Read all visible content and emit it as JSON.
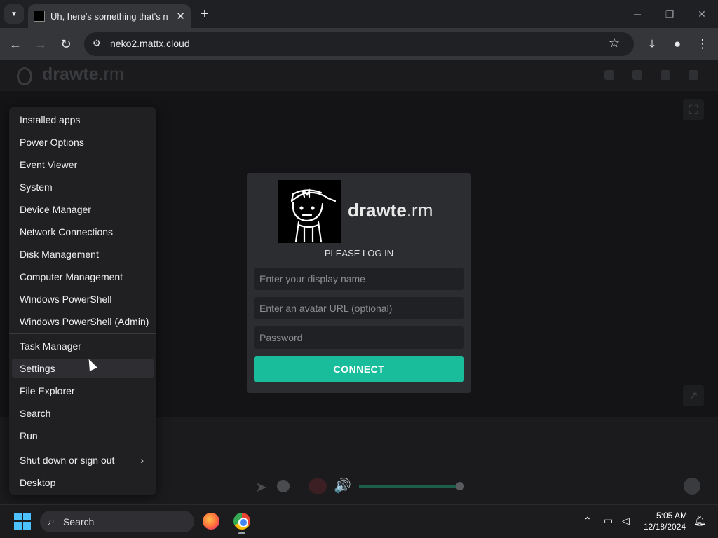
{
  "browser": {
    "tab_title": "Uh, here's something that's new",
    "tab_close": "✕",
    "new_tab": "+",
    "url": "neko2.mattx.cloud"
  },
  "app": {
    "brand_bold": "drawte",
    "brand_light": ".rm"
  },
  "login": {
    "brand_bold": "drawte",
    "brand_light": ".rm",
    "title": "PLEASE LOG IN",
    "display_name_placeholder": "Enter your display name",
    "avatar_placeholder": "Enter an avatar URL (optional)",
    "password_placeholder": "Password",
    "connect_label": "CONNECT"
  },
  "winx_menu": {
    "items": [
      "Installed apps",
      "Power Options",
      "Event Viewer",
      "System",
      "Device Manager",
      "Network Connections",
      "Disk Management",
      "Computer Management",
      "Windows PowerShell",
      "Windows PowerShell (Admin)",
      "Task Manager",
      "Settings",
      "File Explorer",
      "Search",
      "Run",
      "Shut down or sign out",
      "Desktop"
    ],
    "hovered": "Settings"
  },
  "taskbar": {
    "search_label": "Search",
    "time": "5:05 AM",
    "date": "12/18/2024"
  },
  "colors": {
    "accent": "#19bd9c",
    "start_blue": "#4cc2ff"
  },
  "icons": [
    "search-icon",
    "back-icon",
    "forward-icon",
    "reload-icon",
    "site-info-icon",
    "star-icon",
    "download-icon",
    "profile-icon",
    "more-icon",
    "chevron-right-icon",
    "windows-start-icon",
    "firefox-icon",
    "chrome-icon",
    "notification-icon"
  ]
}
